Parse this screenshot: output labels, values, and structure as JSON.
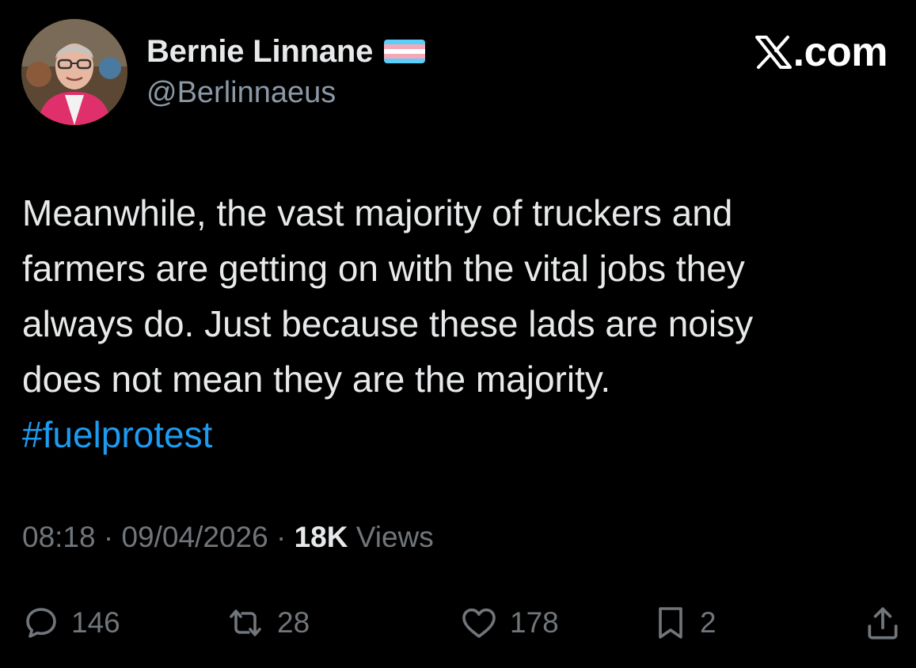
{
  "author": {
    "display_name": "Bernie Linnane",
    "handle": "@Berlinnaeus",
    "flag_icon": "transgender-flag-icon",
    "flag_colors": [
      "#5bcefa",
      "#f5a9b8",
      "#ffffff",
      "#f5a9b8",
      "#5bcefa"
    ]
  },
  "brand": {
    "label": ".com",
    "icon": "x-logo-icon"
  },
  "tweet": {
    "lines": [
      "Meanwhile, the vast majority of truckers and",
      "farmers are getting on with the vital jobs they",
      "always do. Just because these lads are noisy",
      "does not mean they are the majority."
    ],
    "hashtag": "#fuelprotest"
  },
  "meta": {
    "time": "08:18",
    "separator": " · ",
    "date": "09/04/2026",
    "views_count": "18K",
    "views_label": " Views"
  },
  "actions": {
    "reply": {
      "icon": "reply-icon",
      "count": "146"
    },
    "repost": {
      "icon": "repost-icon",
      "count": "28"
    },
    "like": {
      "icon": "heart-icon",
      "count": "178"
    },
    "bookmark": {
      "icon": "bookmark-icon",
      "count": "2"
    },
    "share": {
      "icon": "share-icon"
    }
  },
  "colors": {
    "background": "#000000",
    "text": "#e7e9ea",
    "secondary": "#71767b",
    "accent": "#1d9bf0"
  }
}
